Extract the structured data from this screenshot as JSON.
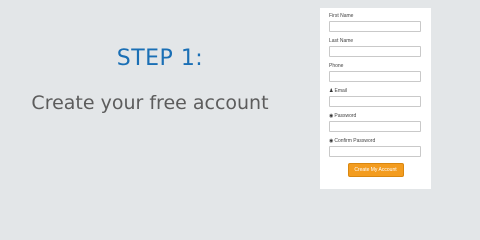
{
  "hero": {
    "step": "STEP 1:",
    "subtitle": "Create your free account"
  },
  "form": {
    "fields": [
      {
        "label": "First Name",
        "value": "",
        "icon": ""
      },
      {
        "label": "Last Name",
        "value": "",
        "icon": ""
      },
      {
        "label": "Phone",
        "value": "",
        "icon": ""
      },
      {
        "label": "Email",
        "value": "",
        "icon": "person-icon"
      },
      {
        "label": "Password",
        "value": "",
        "icon": "lock-icon"
      },
      {
        "label": "Confirm Password",
        "value": "",
        "icon": "lock-icon"
      }
    ],
    "submit_label": "Create My Account"
  },
  "colors": {
    "background": "#e3e6e8",
    "step_title": "#1a6fb5",
    "subtitle": "#5c5c5c",
    "button": "#f39c1f"
  }
}
